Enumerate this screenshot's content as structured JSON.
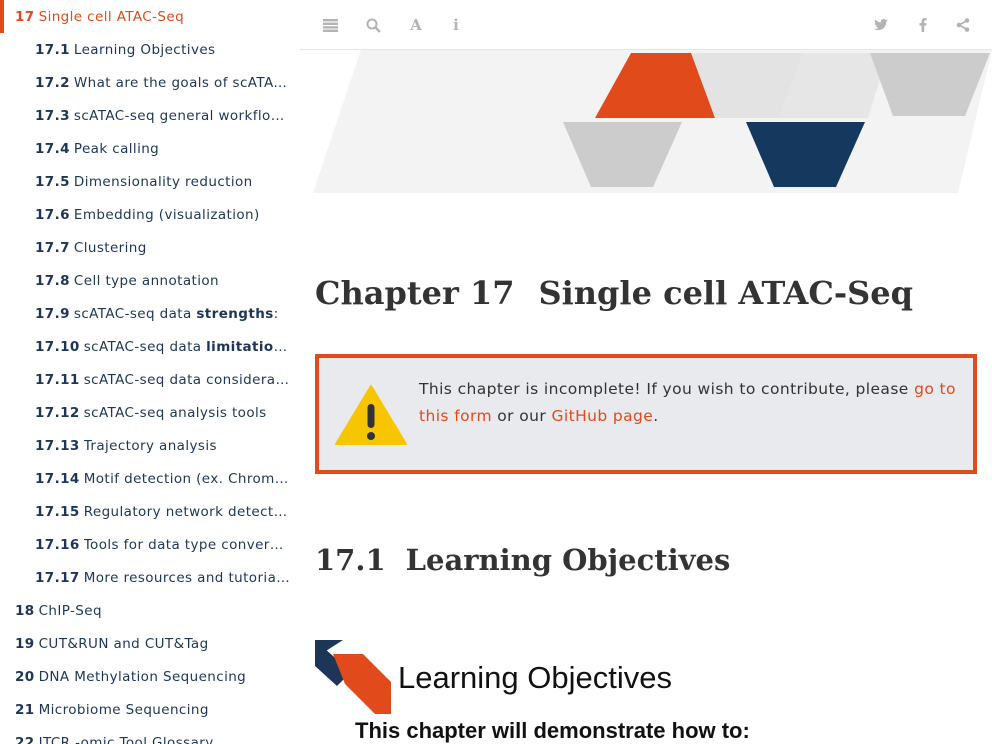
{
  "sidebar": {
    "items": [
      {
        "num": "17",
        "label": "Single cell ATAC-Seq",
        "active": true,
        "level": 1
      },
      {
        "num": "17.1",
        "label": "Learning Objectives",
        "level": 2
      },
      {
        "num": "17.2",
        "label": "What are the goals of scATAC-seq…",
        "level": 2
      },
      {
        "num": "17.3",
        "label": "scATAC-seq general workflow ove…",
        "level": 2
      },
      {
        "num": "17.4",
        "label": "Peak calling",
        "level": 2
      },
      {
        "num": "17.5",
        "label": "Dimensionality reduction",
        "level": 2
      },
      {
        "num": "17.6",
        "label": "Embedding (visualization)",
        "level": 2
      },
      {
        "num": "17.7",
        "label": "Clustering",
        "level": 2
      },
      {
        "num": "17.8",
        "label": "Cell type annotation",
        "level": 2
      },
      {
        "num": "17.9",
        "label_pre": "scATAC-seq data ",
        "label_em": "strengths",
        "label_post": ":",
        "level": 2
      },
      {
        "num": "17.10",
        "label_pre": "scATAC-seq data ",
        "label_em": "limitations",
        "label_post": ":",
        "level": 2
      },
      {
        "num": "17.11",
        "label": "scATAC-seq data considerations",
        "level": 2
      },
      {
        "num": "17.12",
        "label": "scATAC-seq analysis tools",
        "level": 2
      },
      {
        "num": "17.13",
        "label": "Trajectory analysis",
        "level": 2
      },
      {
        "num": "17.14",
        "label": "Motif detection (ex. ChromVar)",
        "level": 2
      },
      {
        "num": "17.15",
        "label": "Regulatory network detection",
        "level": 2
      },
      {
        "num": "17.16",
        "label": "Tools for data type conversion",
        "level": 2
      },
      {
        "num": "17.17",
        "label": "More resources and tutorials ab…",
        "level": 2
      },
      {
        "num": "18",
        "label": "ChIP-Seq",
        "level": 1
      },
      {
        "num": "19",
        "label": "CUT&RUN and CUT&Tag",
        "level": 1
      },
      {
        "num": "20",
        "label": "DNA Methylation Sequencing",
        "level": 1
      },
      {
        "num": "21",
        "label": "Microbiome Sequencing",
        "level": 1
      },
      {
        "num": "22",
        "label": "ITCR -omic Tool Glossary",
        "level": 1
      }
    ]
  },
  "toolbar": {
    "left_icons": [
      "menu-icon",
      "search-icon",
      "font-icon",
      "info-icon"
    ],
    "right_icons": [
      "twitter-icon",
      "facebook-icon",
      "share-icon"
    ]
  },
  "chapter": {
    "number": "Chapter 17",
    "title": "Single cell ATAC-Seq"
  },
  "callout": {
    "text_before": "This chapter is incomplete! If you wish to contribute, please ",
    "link1": "go to this form",
    "text_middle": " or our ",
    "link2": "GitHub page",
    "text_after": ".",
    "icon": "warning-icon"
  },
  "section": {
    "number": "17.1",
    "title": "Learning Objectives"
  },
  "learning_box": {
    "title": "Learning Objectives",
    "subtitle": "This chapter will demonstrate how to:"
  },
  "colors": {
    "accent": "#e14a1b",
    "navy": "#1d3557",
    "gray": "#cccccc",
    "callout_bg": "#e8eaed"
  }
}
